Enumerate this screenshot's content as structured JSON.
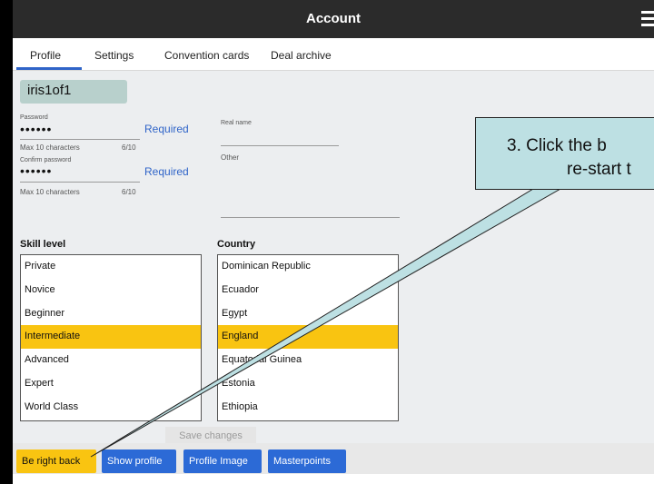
{
  "window": {
    "title": "Account"
  },
  "tabs": [
    {
      "label": "Profile"
    },
    {
      "label": "Settings"
    },
    {
      "label": "Convention cards"
    },
    {
      "label": "Deal archive"
    }
  ],
  "profile": {
    "username": "iris1of1",
    "password_label": "Password",
    "password_value": "••••••",
    "password_required": "Required",
    "password_hint": "Max 10 characters",
    "password_count": "6/10",
    "confirm_label": "Confirm password",
    "confirm_value": "••••••",
    "confirm_required": "Required",
    "confirm_hint": "Max 10 characters",
    "confirm_count": "6/10",
    "real_name_label": "Real name",
    "other_label": "Other"
  },
  "skill": {
    "label": "Skill level",
    "items": [
      "Private",
      "Novice",
      "Beginner",
      "Intermediate",
      "Advanced",
      "Expert",
      "World Class"
    ],
    "selected": "Intermediate"
  },
  "country": {
    "label": "Country",
    "items": [
      "Dominican Republic",
      "Ecuador",
      "Egypt",
      "England",
      "Equatorial Guinea",
      "Estonia",
      "Ethiopia"
    ],
    "selected": "England"
  },
  "save_label": "Save changes",
  "buttons": {
    "be_right_back": "Be right back",
    "show_profile": "Show profile",
    "profile_image": "Profile Image",
    "masterpoints": "Masterpoints"
  },
  "callout": {
    "line1": "3.   Click the b",
    "line2": "re-start t"
  },
  "colors": {
    "accent": "#2c6ad6",
    "selection": "#f9c411",
    "callout": "#bde0e3"
  }
}
